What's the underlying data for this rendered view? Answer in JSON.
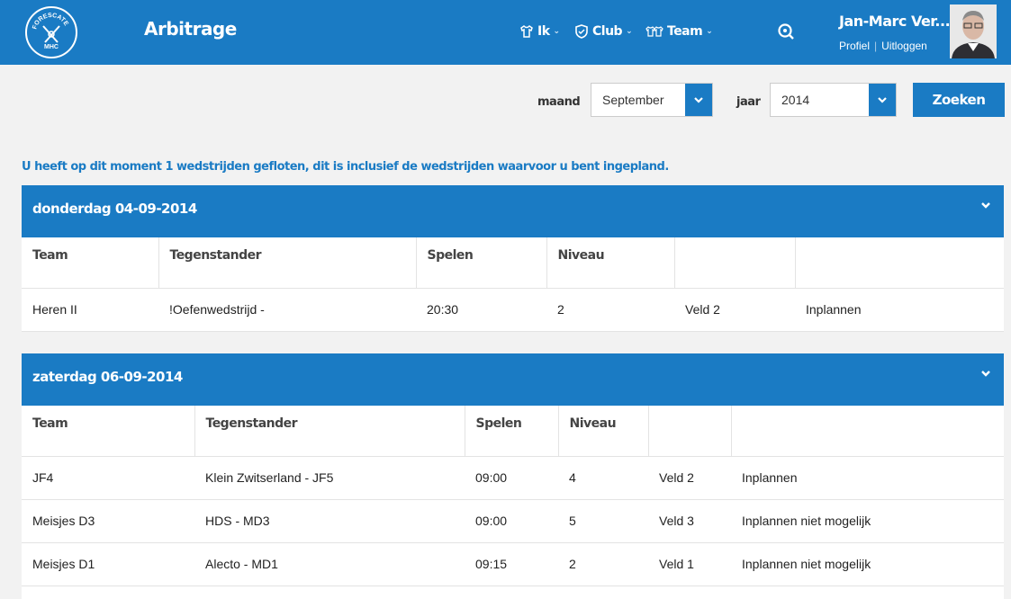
{
  "header": {
    "title": "Arbitrage",
    "nav": [
      {
        "label": "Ik",
        "icon": "shirt-icon"
      },
      {
        "label": "Club",
        "icon": "shield-icon"
      },
      {
        "label": "Team",
        "icon": "team-shirts-icon"
      }
    ],
    "user_name": "Jan-Marc Ver...",
    "profile_link": "Profiel",
    "logout_link": "Uitloggen",
    "logo_text": "FORESCATE MHC"
  },
  "filter": {
    "month_label": "maand",
    "month_value": "September",
    "year_label": "jaar",
    "year_value": "2014",
    "search_button": "Zoeken"
  },
  "intro": "U heeft op dit moment 1 wedstrijden gefloten, dit is inclusief de wedstrijden waarvoor u bent ingepland.",
  "columns": {
    "team": "Team",
    "opponent": "Tegenstander",
    "time": "Spelen",
    "level": "Niveau"
  },
  "days": [
    {
      "date": "donderdag 04-09-2014",
      "rows": [
        {
          "team": "Heren II",
          "opponent": "!Oefenwedstrijd -",
          "time": "20:30",
          "level": "2",
          "field": "Veld 2",
          "action": "Inplannen"
        }
      ]
    },
    {
      "date": "zaterdag 06-09-2014",
      "rows": [
        {
          "team": "JF4",
          "opponent": "Klein Zwitserland - JF5",
          "time": "09:00",
          "level": "4",
          "field": "Veld 2",
          "action": "Inplannen"
        },
        {
          "team": "Meisjes D3",
          "opponent": "HDS - MD3",
          "time": "09:00",
          "level": "5",
          "field": "Veld 3",
          "action": "Inplannen niet mogelijk"
        },
        {
          "team": "Meisjes D1",
          "opponent": "Alecto - MD1",
          "time": "09:15",
          "level": "2",
          "field": "Veld 1",
          "action": "Inplannen niet mogelijk"
        }
      ]
    }
  ],
  "colors": {
    "brand_blue": "#1a7bc4",
    "background": "#f2f2f2"
  }
}
